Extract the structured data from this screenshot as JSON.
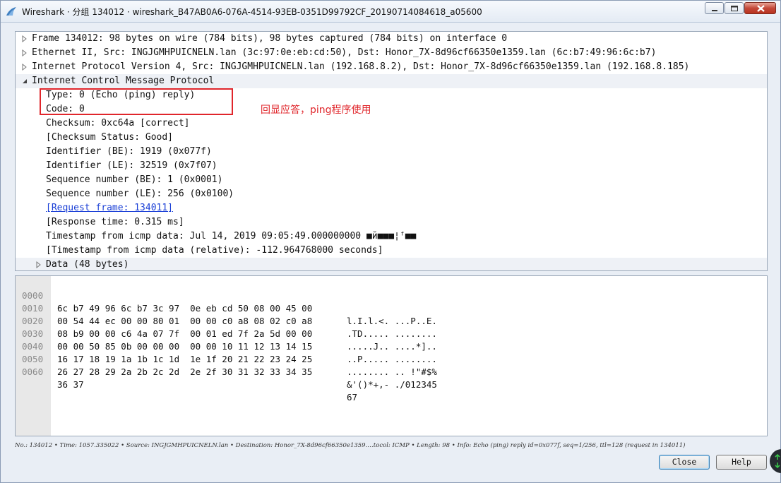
{
  "window": {
    "title": "Wireshark · 分组 134012 · wireshark_B47AB0A6-076A-4514-93EB-0351D99792CF_20190714084618_a05600"
  },
  "tree": {
    "rows": [
      {
        "text": "Frame 134012: 98 bytes on wire (784 bits), 98 bytes captured (784 bits) on interface 0",
        "expander": "collapsed"
      },
      {
        "text": "Ethernet II, Src: INGJGMHPUICNELN.lan (3c:97:0e:eb:cd:50), Dst: Honor_7X-8d96cf66350e1359.lan (6c:b7:49:96:6c:b7)",
        "expander": "collapsed"
      },
      {
        "text": "Internet Protocol Version 4, Src: INGJGMHPUICNELN.lan (192.168.8.2), Dst: Honor_7X-8d96cf66350e1359.lan (192.168.8.185)",
        "expander": "collapsed"
      },
      {
        "text": "Internet Control Message Protocol",
        "expander": "expanded"
      },
      {
        "text": "Type: 0 (Echo (ping) reply)"
      },
      {
        "text": "Code: 0"
      },
      {
        "text": "Checksum: 0xc64a [correct]"
      },
      {
        "text": "[Checksum Status: Good]"
      },
      {
        "text": "Identifier (BE): 1919 (0x077f)"
      },
      {
        "text": "Identifier (LE): 32519 (0x7f07)"
      },
      {
        "text": "Sequence number (BE): 1 (0x0001)"
      },
      {
        "text": "Sequence number (LE): 256 (0x0100)"
      },
      {
        "text": "[Request frame: 134011]",
        "link": true
      },
      {
        "text": "[Response time: 0.315 ms]"
      },
      {
        "text": "Timestamp from icmp data: Jul 14, 2019 09:05:49.000000000 ■й■■■¦ᶠ■■"
      },
      {
        "text": "[Timestamp from icmp data (relative): -112.964768000 seconds]"
      },
      {
        "text": "Data (48 bytes)",
        "expander": "collapsed"
      }
    ],
    "annotation": "回显应答，ping程序使用"
  },
  "hex": {
    "rows": [
      {
        "off": "0000",
        "bytes": "6c b7 49 96 6c b7 3c 97  0e eb cd 50 08 00 45 00",
        "ascii": "l.I.l.<. ...P..E."
      },
      {
        "off": "0010",
        "bytes": "00 54 44 ec 00 00 80 01  00 00 c0 a8 08 02 c0 a8",
        "ascii": ".TD..... ........"
      },
      {
        "off": "0020",
        "bytes": "08 b9 00 00 c6 4a 07 7f  00 01 ed 7f 2a 5d 00 00",
        "ascii": ".....J.. ....*].."
      },
      {
        "off": "0030",
        "bytes": "00 00 50 85 0b 00 00 00  00 00 10 11 12 13 14 15",
        "ascii": "..P..... ........"
      },
      {
        "off": "0040",
        "bytes": "16 17 18 19 1a 1b 1c 1d  1e 1f 20 21 22 23 24 25",
        "ascii": "........ .. !\"#$%"
      },
      {
        "off": "0050",
        "bytes": "26 27 28 29 2a 2b 2c 2d  2e 2f 30 31 32 33 34 35",
        "ascii": "&'()*+,- ./012345"
      },
      {
        "off": "0060",
        "bytes": "36 37",
        "ascii": "67"
      }
    ]
  },
  "status_bar": {
    "text": "No.: 134012 • Time: 1057.335022 • Source: INGJGMHPUICNELN.lan • Destination: Honor_7X-8d96cf66350e1359.…tocol: ICMP • Length: 98 • Info: Echo (ping) reply id=0x077f, seq=1/256, ttl=128 (request in 134011)"
  },
  "buttons": {
    "close": "Close",
    "help": "Help"
  },
  "icons": {
    "app": "wireshark-fin-icon",
    "minimize": "minimize-icon",
    "maximize": "maximize-icon",
    "close": "close-icon"
  },
  "colors": {
    "annotation": "#e0262b",
    "link": "#1a3fd6",
    "close_button": "#c4493a"
  }
}
